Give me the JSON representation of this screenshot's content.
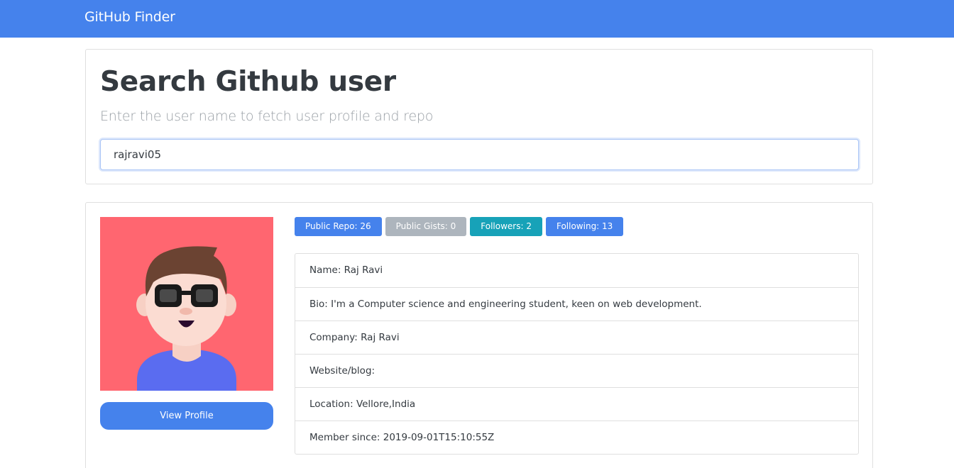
{
  "navbar": {
    "brand": "GitHub Finder"
  },
  "search": {
    "title": "Search Github user",
    "subtitle": "Enter the user name to fetch user profile and repo",
    "input_value": "rajravi05"
  },
  "profile": {
    "avatar_icon": "user-avatar-glasses",
    "view_profile_label": "View Profile",
    "badges": [
      {
        "label": "Public Repo: 26",
        "color": "#4582ec"
      },
      {
        "label": "Public Gists: 0",
        "color": "#adb5bd"
      },
      {
        "label": "Followers: 2",
        "color": "#17a2b8"
      },
      {
        "label": "Following: 13",
        "color": "#4582ec"
      }
    ],
    "details": [
      "Name: Raj Ravi",
      "Bio: I'm a Computer science and engineering student, keen on web development.",
      "Company: Raj Ravi",
      "Website/blog:",
      "Location: Vellore,India",
      "Member since: 2019-09-01T15:10:55Z"
    ]
  },
  "colors": {
    "primary": "#4582ec",
    "secondary": "#adb5bd",
    "info": "#17a2b8",
    "avatar_background": "#ff6670"
  }
}
